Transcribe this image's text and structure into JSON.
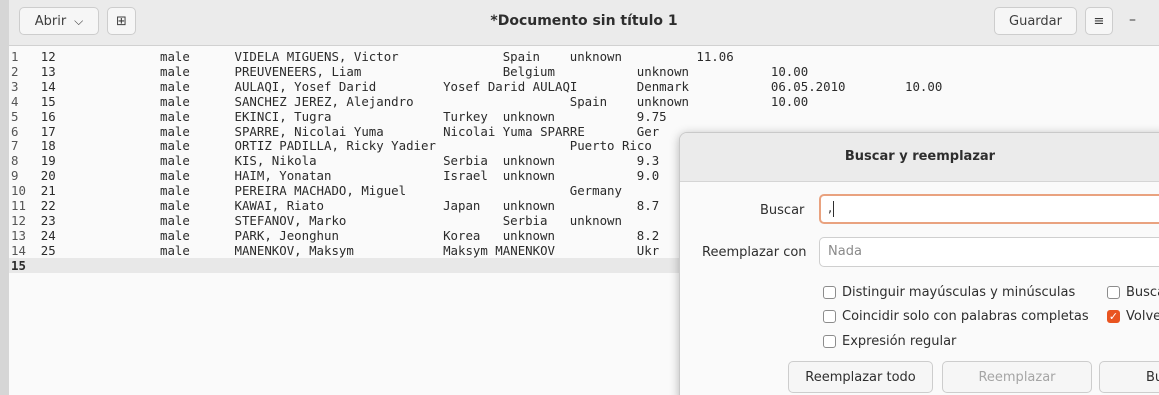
{
  "header": {
    "open_label": "Abrir",
    "open_chevron": "⌵",
    "new_tab_icon": "⊞",
    "title": "*Documento sin título 1",
    "save_label": "Guardar",
    "menu_icon": "≡",
    "minimize_icon": "–"
  },
  "editor": {
    "lines": [
      {
        "n": "1",
        "cells": [
          "12",
          "male",
          "VIDELA MIGUENS, Victor",
          "Spain",
          "unknown",
          "",
          "11.06"
        ]
      },
      {
        "n": "2",
        "cells": [
          "13",
          "male",
          "PREUVENEERS, Liam",
          "Belgium",
          "",
          "unknown",
          "10.00"
        ]
      },
      {
        "n": "3",
        "cells": [
          "14",
          "male",
          "AULAQI, Yosef Darid",
          "Yosef Darid AULAQI",
          "",
          "Denmark",
          "06.05.2010",
          "10.00"
        ]
      },
      {
        "n": "4",
        "cells": [
          "15",
          "male",
          "SANCHEZ JEREZ, Alejandro",
          "",
          "Spain",
          "unknown",
          "10.00"
        ]
      },
      {
        "n": "5",
        "cells": [
          "16",
          "male",
          "EKINCI, Tugra",
          "Turkey",
          "unknown",
          "9.75"
        ]
      },
      {
        "n": "6",
        "cells": [
          "17",
          "male",
          "SPARRE, Nicolai Yuma",
          "Nicolai Yuma SPARRE",
          "Ger"
        ]
      },
      {
        "n": "7",
        "cells": [
          "18",
          "male",
          "ORTIZ PADILLA, Ricky Yadier",
          "",
          "Puerto Rico"
        ]
      },
      {
        "n": "8",
        "cells": [
          "19",
          "male",
          "KIS, Nikola",
          "Serbia",
          "unknown",
          "9.3"
        ]
      },
      {
        "n": "9",
        "cells": [
          "20",
          "male",
          "HAIM, Yonatan",
          "Israel",
          "unknown",
          "9.0"
        ]
      },
      {
        "n": "10",
        "cells": [
          "21",
          "male",
          "PEREIRA MACHADO, Miguel",
          "",
          "Germany"
        ]
      },
      {
        "n": "11",
        "cells": [
          "22",
          "male",
          "KAWAI, Riato",
          "Japan",
          "unknown",
          "8.7"
        ]
      },
      {
        "n": "12",
        "cells": [
          "23",
          "male",
          "STEFANOV, Marko",
          "Serbia",
          "unknown"
        ]
      },
      {
        "n": "13",
        "cells": [
          "24",
          "male",
          "PARK, Jeonghun",
          "Korea",
          "unknown",
          "8.2"
        ]
      },
      {
        "n": "14",
        "cells": [
          "25",
          "male",
          "MANENKOV, Maksym",
          "Maksym MANENKOV",
          "Ukr"
        ]
      },
      {
        "n": "15",
        "cells": []
      }
    ]
  },
  "dialog": {
    "title": "Buscar y reemplazar",
    "find_label": "Buscar",
    "find_value": ",",
    "replace_label": "Reemplazar con",
    "replace_placeholder": "Nada",
    "opt_case": "Distinguir mayúsculas y minúsculas",
    "opt_backwards": "Buscar",
    "opt_whole": "Coincidir solo con palabras completas",
    "opt_wrap": "Volver",
    "opt_regex": "Expresión regular",
    "btn_replace_all": "Reemplazar todo",
    "btn_replace": "Reemplazar",
    "btn_find": "Bu"
  }
}
